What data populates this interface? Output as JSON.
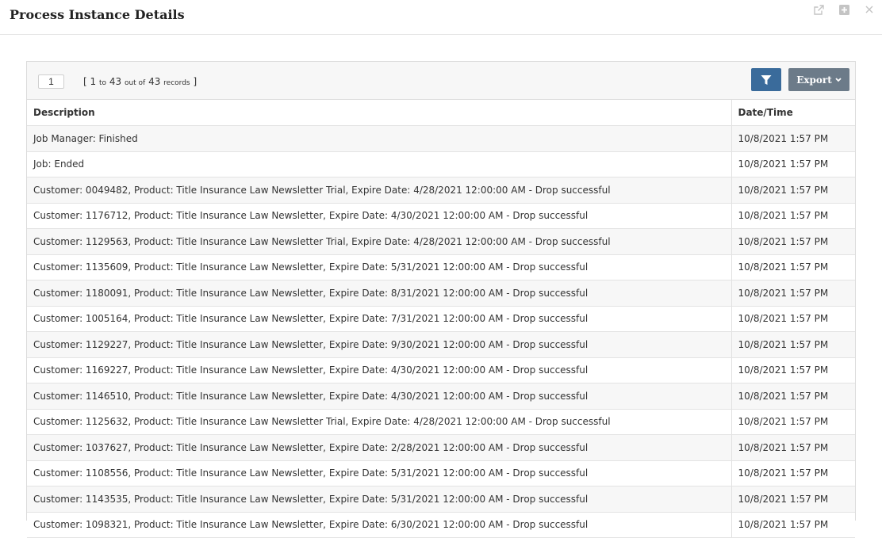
{
  "dialog": {
    "title": "Process Instance Details",
    "controls": [
      {
        "name": "popout-icon"
      },
      {
        "name": "maximize-icon"
      },
      {
        "name": "close-icon"
      }
    ]
  },
  "toolbar": {
    "page": "1",
    "records_open": "[ 1",
    "records_to": "to",
    "records_mid": "43",
    "records_outof": "out of",
    "records_total": "43",
    "records_label": "records",
    "records_close": "]",
    "filter_icon": "filter-icon",
    "export_label": "Export",
    "export_icon": "chevron-down-icon"
  },
  "colors": {
    "filter_button": "#3a6b9b",
    "export_button": "#6c7b89"
  },
  "table": {
    "headers": [
      "Description",
      "Date/Time"
    ],
    "rows": [
      [
        "Job Manager: Finished",
        "10/8/2021 1:57 PM"
      ],
      [
        "Job: Ended",
        "10/8/2021 1:57 PM"
      ],
      [
        "Customer: 0049482, Product: Title Insurance Law Newsletter Trial, Expire Date: 4/28/2021 12:00:00 AM - Drop successful",
        "10/8/2021 1:57 PM"
      ],
      [
        "Customer: 1176712, Product: Title Insurance Law Newsletter, Expire Date: 4/30/2021 12:00:00 AM - Drop successful",
        "10/8/2021 1:57 PM"
      ],
      [
        "Customer: 1129563, Product: Title Insurance Law Newsletter Trial, Expire Date: 4/28/2021 12:00:00 AM - Drop successful",
        "10/8/2021 1:57 PM"
      ],
      [
        "Customer: 1135609, Product: Title Insurance Law Newsletter, Expire Date: 5/31/2021 12:00:00 AM - Drop successful",
        "10/8/2021 1:57 PM"
      ],
      [
        "Customer: 1180091, Product: Title Insurance Law Newsletter, Expire Date: 8/31/2021 12:00:00 AM - Drop successful",
        "10/8/2021 1:57 PM"
      ],
      [
        "Customer: 1005164, Product: Title Insurance Law Newsletter, Expire Date: 7/31/2021 12:00:00 AM - Drop successful",
        "10/8/2021 1:57 PM"
      ],
      [
        "Customer: 1129227, Product: Title Insurance Law Newsletter, Expire Date: 9/30/2021 12:00:00 AM - Drop successful",
        "10/8/2021 1:57 PM"
      ],
      [
        "Customer: 1169227, Product: Title Insurance Law Newsletter, Expire Date: 4/30/2021 12:00:00 AM - Drop successful",
        "10/8/2021 1:57 PM"
      ],
      [
        "Customer: 1146510, Product: Title Insurance Law Newsletter, Expire Date: 4/30/2021 12:00:00 AM - Drop successful",
        "10/8/2021 1:57 PM"
      ],
      [
        "Customer: 1125632, Product: Title Insurance Law Newsletter Trial, Expire Date: 4/28/2021 12:00:00 AM - Drop successful",
        "10/8/2021 1:57 PM"
      ],
      [
        "Customer: 1037627, Product: Title Insurance Law Newsletter, Expire Date: 2/28/2021 12:00:00 AM - Drop successful",
        "10/8/2021 1:57 PM"
      ],
      [
        "Customer: 1108556, Product: Title Insurance Law Newsletter, Expire Date: 5/31/2021 12:00:00 AM - Drop successful",
        "10/8/2021 1:57 PM"
      ],
      [
        "Customer: 1143535, Product: Title Insurance Law Newsletter, Expire Date: 5/31/2021 12:00:00 AM - Drop successful",
        "10/8/2021 1:57 PM"
      ],
      [
        "Customer: 1098321, Product: Title Insurance Law Newsletter, Expire Date: 6/30/2021 12:00:00 AM - Drop successful",
        "10/8/2021 1:57 PM"
      ]
    ]
  }
}
